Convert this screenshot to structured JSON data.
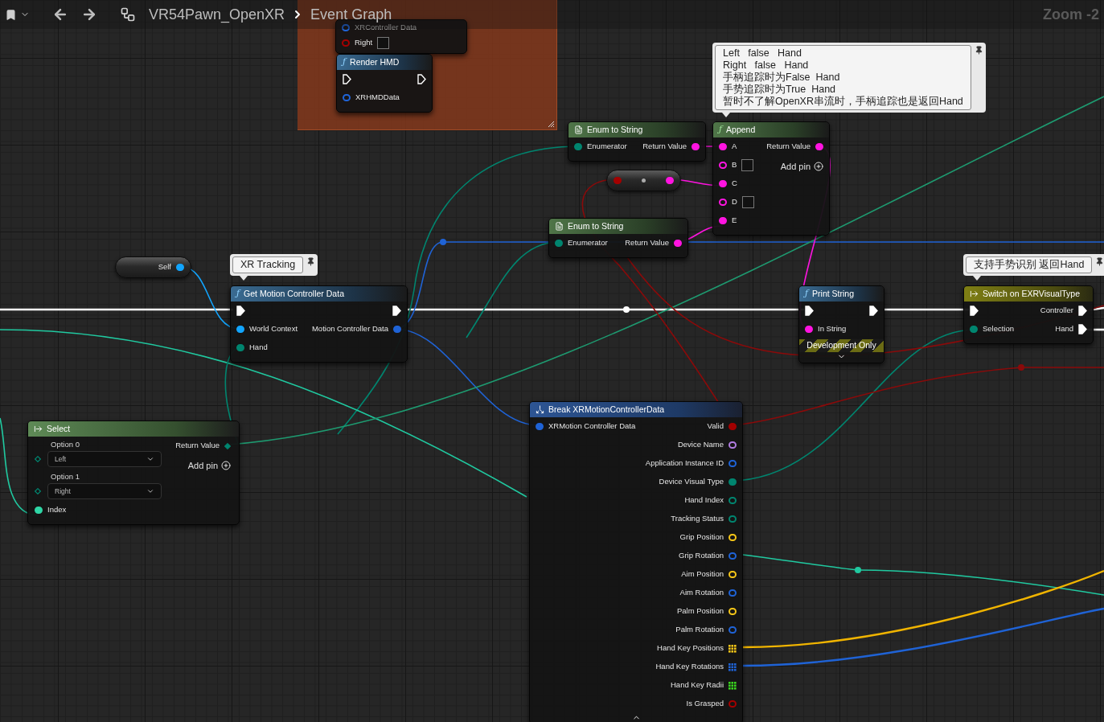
{
  "breadcrumb": {
    "asset": "VR54Pawn_OpenXR",
    "graph": "Event Graph"
  },
  "zoom_label": "Zoom -2",
  "comment_bubbles": [
    {
      "lines": [
        "XR Tracking"
      ]
    },
    {
      "lines": [
        "Left   false   Hand",
        "Right   false   Hand",
        "手柄追踪时为False  Hand",
        "手势追踪时为True  Hand",
        "暂时不了解OpenXR串流时，手柄追踪也是返回Hand"
      ]
    },
    {
      "lines": [
        "支持手势识别 返回Hand"
      ]
    }
  ],
  "nodes": [
    {
      "kind": "function",
      "inputs": [
        {
          "kind": "data",
          "label": "XRController Data",
          "color": "#1f63d6",
          "connected": false,
          "dim": true
        },
        {
          "kind": "bool_box",
          "label": "Right",
          "color": "#a30000",
          "connected": false,
          "checked": false
        }
      ]
    },
    {
      "kind": "function",
      "icon": "ƒ",
      "title": "Render HMD",
      "inputs": [
        {
          "kind": "exec",
          "connected": false
        },
        {
          "kind": "data",
          "label": "XRHMDData",
          "color": "#1f63d6",
          "connected": false
        }
      ],
      "outputs": [
        {
          "kind": "exec",
          "connected": false
        }
      ]
    },
    {
      "kind": "enum",
      "title": "Enum to String",
      "inputs": [
        {
          "kind": "data",
          "label": "Enumerator",
          "color": "#00856f",
          "connected": true
        }
      ],
      "outputs": [
        {
          "kind": "data",
          "label": "Return Value",
          "color": "#ff14e0",
          "connected": true
        }
      ]
    },
    {
      "kind": "pure",
      "icon": "ƒ",
      "title": "Append",
      "inputs": [
        {
          "kind": "data",
          "label": "A",
          "color": "#ff14e0",
          "connected": true
        },
        {
          "kind": "data_box",
          "label": "B",
          "color": "#ff14e0",
          "connected": false
        },
        {
          "kind": "data",
          "label": "C",
          "color": "#ff14e0",
          "connected": true
        },
        {
          "kind": "data_box",
          "label": "D",
          "color": "#ff14e0",
          "connected": false
        },
        {
          "kind": "data",
          "label": "E",
          "color": "#ff14e0",
          "connected": true
        }
      ],
      "outputs": [
        {
          "kind": "data",
          "label": "Return Value",
          "color": "#ff14e0",
          "connected": true
        },
        {
          "kind": "add",
          "label": "Add pin"
        }
      ]
    },
    {
      "kind": "compact",
      "inputs": [
        {
          "kind": "data",
          "color": "#a30000",
          "connected": true
        }
      ],
      "outputs": [
        {
          "kind": "data",
          "color": "#ff14e0",
          "connected": true
        }
      ]
    },
    {
      "kind": "enum",
      "title": "Enum to String",
      "inputs": [
        {
          "kind": "data",
          "label": "Enumerator",
          "color": "#00856f",
          "connected": true
        }
      ],
      "outputs": [
        {
          "kind": "data",
          "label": "Return Value",
          "color": "#ff14e0",
          "connected": true
        }
      ]
    },
    {
      "kind": "self",
      "outputs": [
        {
          "kind": "data",
          "label": "Self",
          "color": "#12a5ff",
          "connected": true
        }
      ]
    },
    {
      "kind": "function",
      "icon": "ƒ",
      "title": "Get Motion Controller Data",
      "inputs": [
        {
          "kind": "exec",
          "connected": true
        },
        {
          "kind": "data",
          "label": "World Context",
          "color": "#12a5ff",
          "connected": true
        },
        {
          "kind": "data",
          "label": "Hand",
          "color": "#00856f",
          "connected": true
        }
      ],
      "outputs": [
        {
          "kind": "exec",
          "connected": true
        },
        {
          "kind": "data",
          "label": "Motion Controller Data",
          "color": "#1f63d6",
          "connected": true
        }
      ]
    },
    {
      "kind": "function",
      "icon": "ƒ",
      "title": "Print String",
      "banner": "Development Only",
      "expander": true,
      "inputs": [
        {
          "kind": "exec",
          "connected": true
        },
        {
          "kind": "data",
          "label": "In String",
          "color": "#ff14e0",
          "connected": true
        }
      ],
      "outputs": [
        {
          "kind": "exec",
          "connected": true
        }
      ]
    },
    {
      "kind": "switch",
      "title": "Switch on EXRVisualType",
      "inputs": [
        {
          "kind": "exec",
          "connected": true
        },
        {
          "kind": "data",
          "label": "Selection",
          "color": "#00856f",
          "connected": true
        }
      ],
      "outputs": [
        {
          "kind": "exec",
          "label": "Controller",
          "connected": true
        },
        {
          "kind": "exec",
          "label": "Hand",
          "connected": true
        }
      ]
    },
    {
      "kind": "select",
      "title": "Select",
      "inputs": [
        {
          "kind": "option",
          "label": "Option 0",
          "value": "Left",
          "color": "#00856f",
          "connected": false
        },
        {
          "kind": "option",
          "label": "Option 1",
          "value": "Right",
          "color": "#00856f",
          "connected": false
        },
        {
          "kind": "data",
          "label": "Index",
          "color": "#2fd6a6",
          "connected": true
        }
      ],
      "outputs": [
        {
          "kind": "diamond",
          "label": "Return Value",
          "color": "#00856f",
          "connected": true
        },
        {
          "kind": "add",
          "label": "Add pin"
        }
      ]
    },
    {
      "kind": "break",
      "title": "Break XRMotionControllerData",
      "expander": true,
      "inputs": [
        {
          "kind": "data",
          "label": "XRMotion Controller Data",
          "color": "#1f63d6",
          "connected": true
        }
      ],
      "outputs": [
        {
          "kind": "data",
          "label": "Valid",
          "color": "#a30000",
          "connected": true
        },
        {
          "kind": "data",
          "label": "Device Name",
          "color": "#b07ce0",
          "connected": false
        },
        {
          "kind": "data",
          "label": "Application Instance ID",
          "color": "#1f63d6",
          "connected": false
        },
        {
          "kind": "data",
          "label": "Device Visual Type",
          "color": "#00856f",
          "connected": true
        },
        {
          "kind": "data",
          "label": "Hand Index",
          "color": "#00856f",
          "connected": false
        },
        {
          "kind": "data",
          "label": "Tracking Status",
          "color": "#00856f",
          "connected": false
        },
        {
          "kind": "data",
          "label": "Grip Position",
          "color": "#f5c518",
          "connected": false
        },
        {
          "kind": "data",
          "label": "Grip Rotation",
          "color": "#1f63d6",
          "connected": false
        },
        {
          "kind": "data",
          "label": "Aim Position",
          "color": "#f5c518",
          "connected": false
        },
        {
          "kind": "data",
          "label": "Aim Rotation",
          "color": "#1f63d6",
          "connected": false
        },
        {
          "kind": "data",
          "label": "Palm Position",
          "color": "#f5c518",
          "connected": false
        },
        {
          "kind": "data",
          "label": "Palm Rotation",
          "color": "#1f63d6",
          "connected": false
        },
        {
          "kind": "array",
          "label": "Hand Key Positions",
          "color": "#f5c518"
        },
        {
          "kind": "array",
          "label": "Hand Key Rotations",
          "color": "#1f63d6"
        },
        {
          "kind": "array",
          "label": "Hand Key Radii",
          "color": "#3ad61f"
        },
        {
          "kind": "data",
          "label": "Is Grasped",
          "color": "#a30000",
          "connected": false
        }
      ]
    }
  ]
}
